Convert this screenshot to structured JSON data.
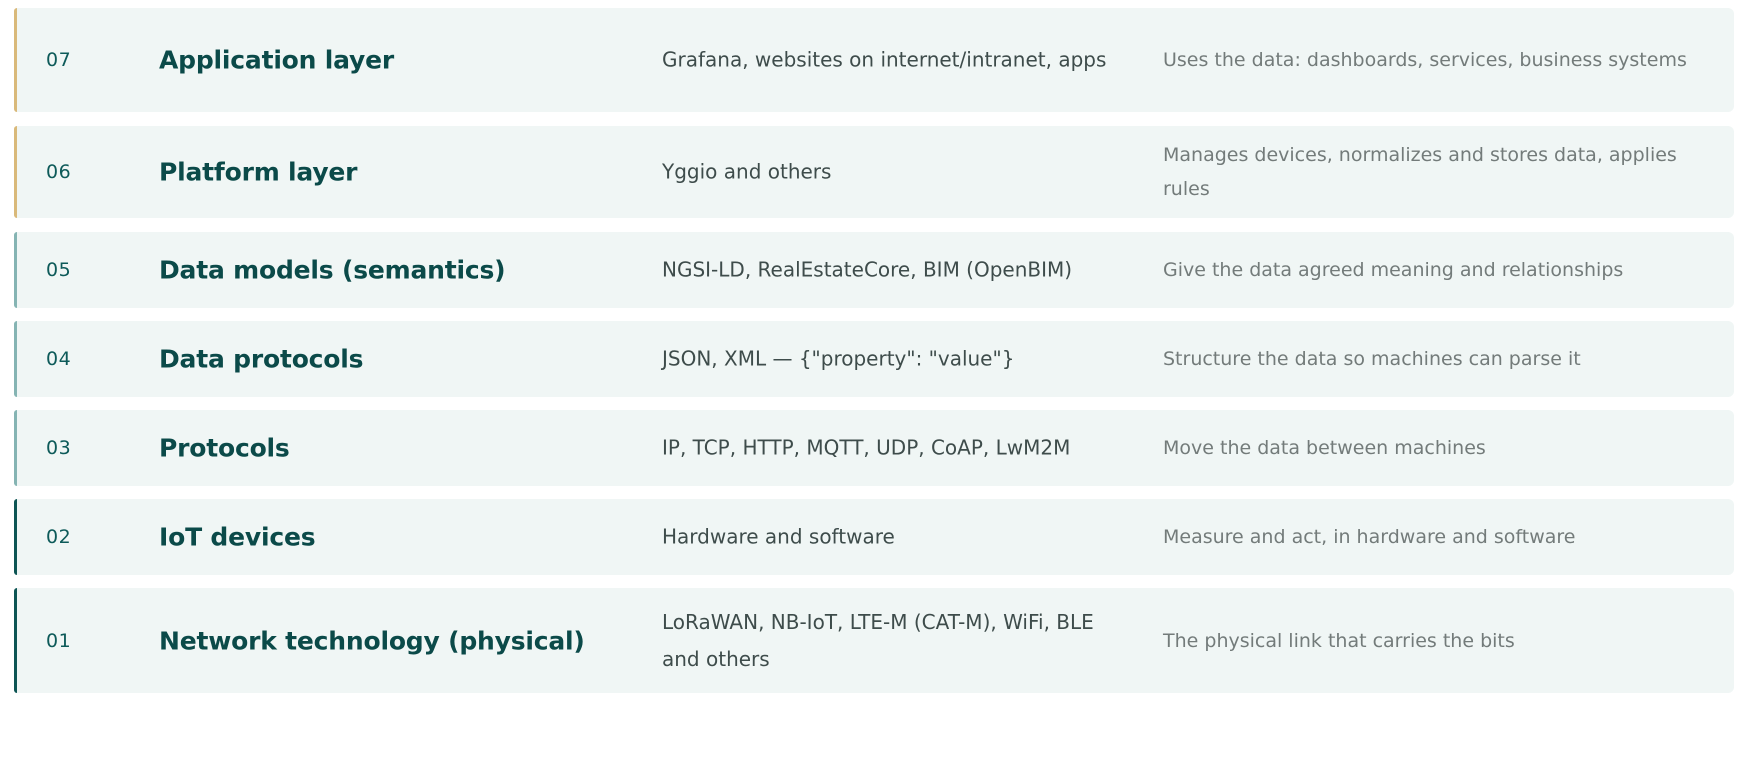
{
  "layers": [
    {
      "number": "07",
      "name": "Application layer",
      "technologies": "Grafana, websites on internet/intranet, apps",
      "role": "Uses the data: dashboards, services, business systems",
      "accent_color": "#d9b97a"
    },
    {
      "number": "06",
      "name": "Platform layer",
      "technologies": "Yggio and others",
      "role": "Manages devices, normalizes and stores data, applies rules",
      "accent_color": "#d9b97a"
    },
    {
      "number": "05",
      "name": "Data models (semantics)",
      "technologies": "NGSI-LD, RealEstateCore, BIM (OpenBIM)",
      "role": "Give the data agreed meaning and relationships",
      "accent_color": "#85b4b3"
    },
    {
      "number": "04",
      "name": "Data protocols",
      "technologies": "JSON, XML — {\"property\": \"value\"}",
      "role": "Structure the data so machines can parse it",
      "accent_color": "#85b4b3"
    },
    {
      "number": "03",
      "name": "Protocols",
      "technologies": "IP, TCP, HTTP, MQTT, UDP, CoAP, LwM2M",
      "role": "Move the data between machines",
      "accent_color": "#85b4b3"
    },
    {
      "number": "02",
      "name": "IoT devices",
      "technologies": "Hardware and software",
      "role": "Measure and act, in hardware and software",
      "accent_color": "#0d5554"
    },
    {
      "number": "01",
      "name": "Network technology (physical)",
      "technologies": "LoRaWAN, NB-IoT, LTE-M (CAT-M), WiFi, BLE and others",
      "role": "The physical link that carries the bits",
      "accent_color": "#0d5554"
    }
  ],
  "colors": {
    "row_background": "#f0f6f5",
    "number_text": "#0d5a59",
    "name_text": "#0b4a49",
    "technology_text": "#3e4c4b",
    "role_text": "#737b7a"
  }
}
